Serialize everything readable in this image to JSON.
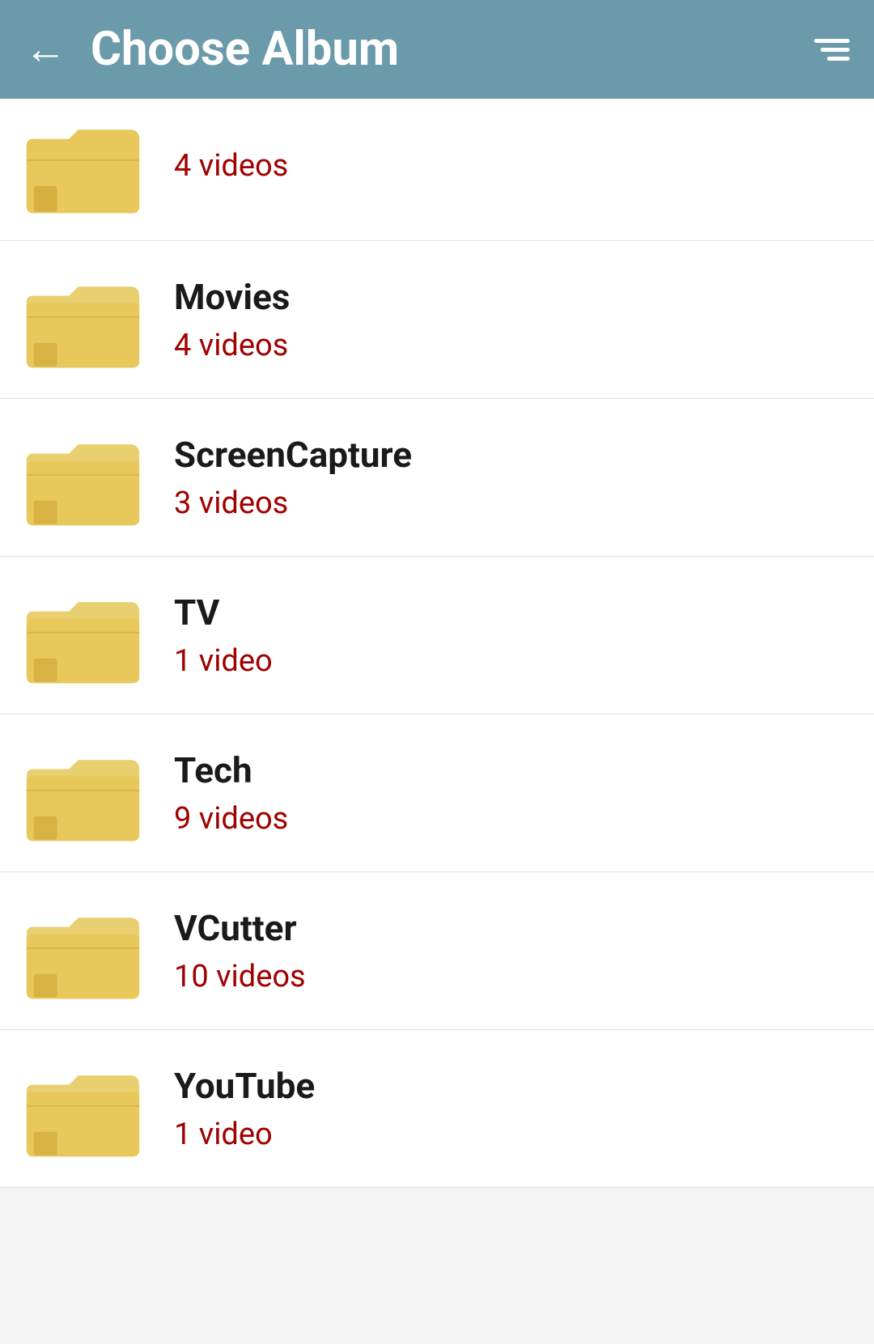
{
  "header": {
    "title": "Choose Album",
    "back_label": "←",
    "back_aria": "Back"
  },
  "albums_partial": [
    {
      "count": "4 videos"
    }
  ],
  "albums": [
    {
      "name": "Movies",
      "count": "4 videos"
    },
    {
      "name": "ScreenCapture",
      "count": "3 videos"
    },
    {
      "name": "TV",
      "count": "1 video"
    },
    {
      "name": "Tech",
      "count": "9 videos"
    },
    {
      "name": "VCutter",
      "count": "10 videos"
    },
    {
      "name": "YouTube",
      "count": "1 video"
    }
  ],
  "colors": {
    "header_bg": "#6b9aaa",
    "count_color": "#a00000"
  }
}
